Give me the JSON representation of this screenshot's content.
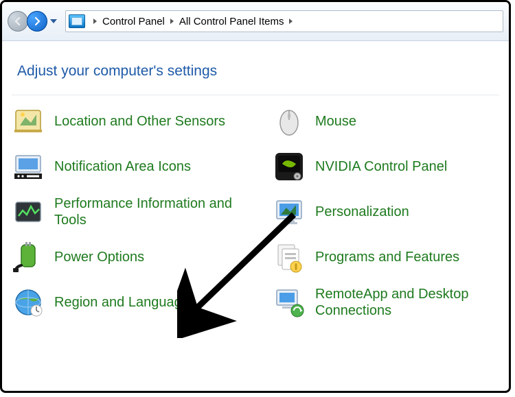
{
  "breadcrumb": {
    "items": [
      "Control Panel",
      "All Control Panel Items"
    ]
  },
  "heading": "Adjust your computer's settings",
  "panel_items": {
    "left": [
      "Location and Other Sensors",
      "Notification Area Icons",
      "Performance Information and Tools",
      "Power Options",
      "Region and Language"
    ],
    "right": [
      "Mouse",
      "NVIDIA Control Panel",
      "Personalization",
      "Programs and Features",
      "RemoteApp and Desktop Connections"
    ]
  },
  "colors": {
    "link": "#1e7a1e",
    "heading": "#1e5aa8"
  }
}
